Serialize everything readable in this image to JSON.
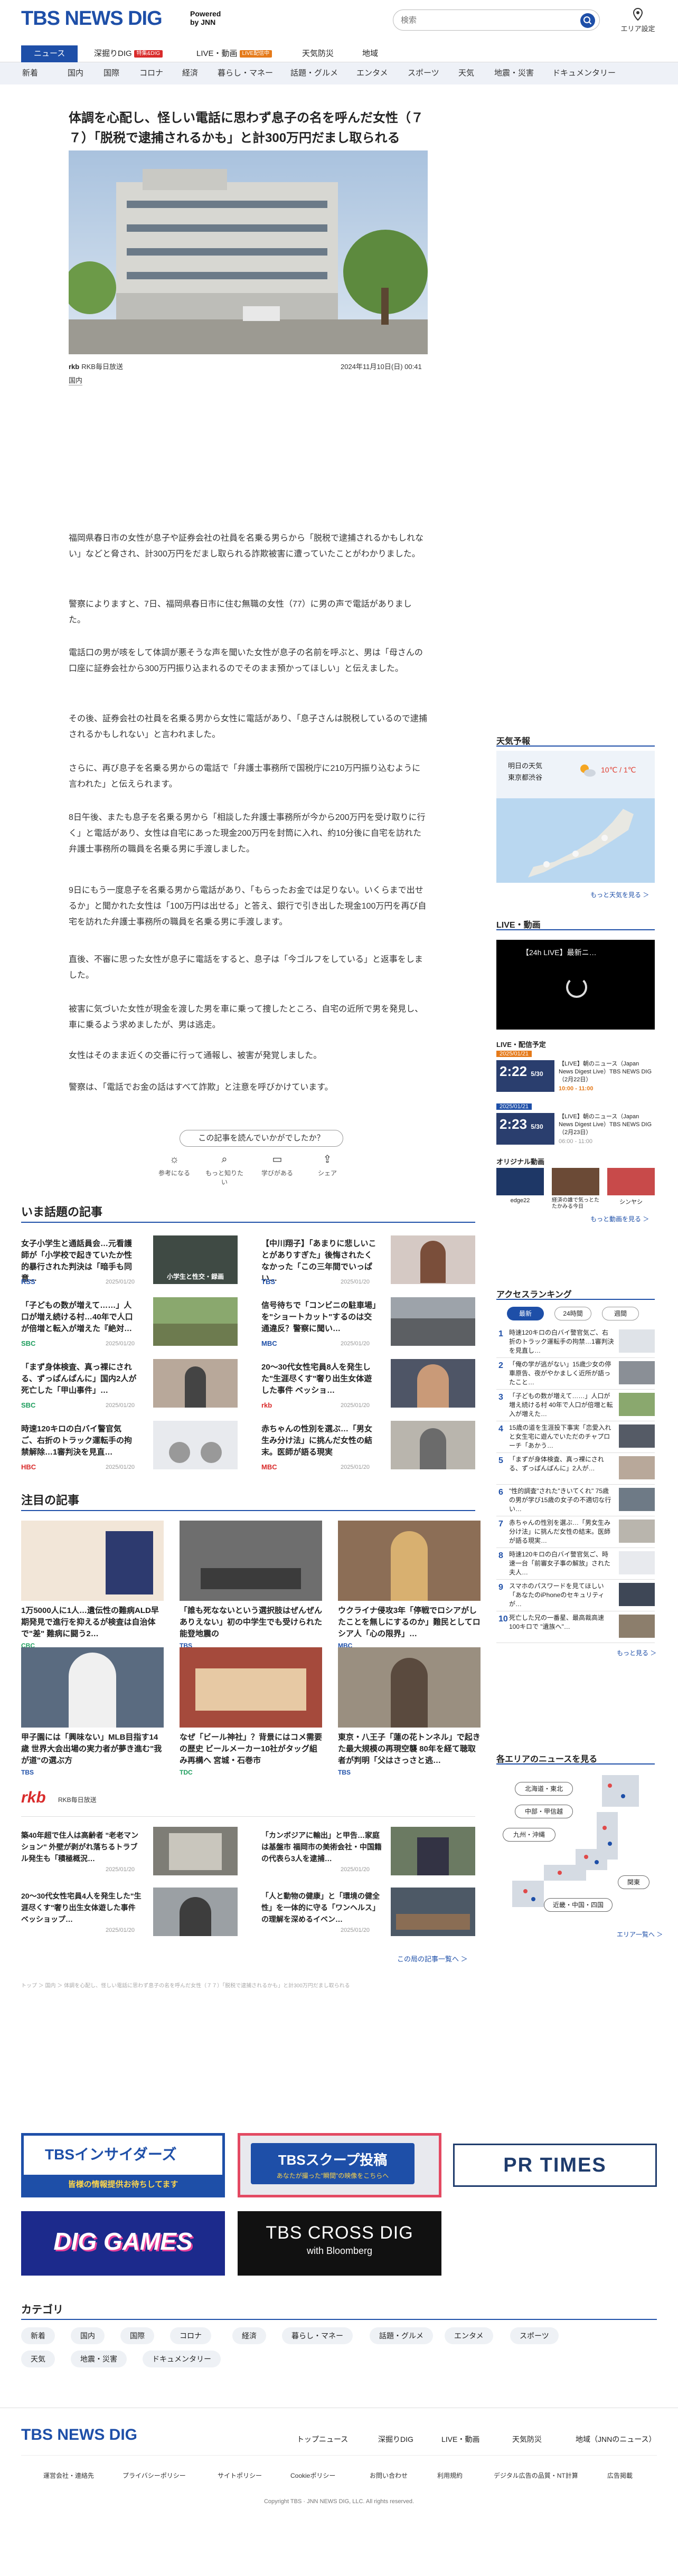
{
  "header": {
    "logo": "TBS NEWS DIG",
    "powered": "Powered",
    "powered_by": "by JNN",
    "search_placeholder": "検索",
    "area_label": "エリア設定"
  },
  "nav": [
    {
      "label": "ニュース",
      "active": true
    },
    {
      "label": "深掘りDIG",
      "badge": "特集&DIG",
      "badge_color": "#d92b2b"
    },
    {
      "label": "LIVE・動画",
      "badge": "LIVE配信中",
      "badge_color": "#e57a1a"
    },
    {
      "label": "天気防災"
    },
    {
      "label": "地域"
    }
  ],
  "subnav": [
    "新着",
    "国内",
    "国際",
    "コロナ",
    "経済",
    "暮らし・マネー",
    "話題・グルメ",
    "エンタメ",
    "スポーツ",
    "天気",
    "地震・災害",
    "ドキュメンタリー"
  ],
  "article": {
    "title": "体調を心配し、怪しい電話に思わず息子の名を呼んだ女性（７７）「脱税で逮捕されるかも」と計300万円だまし取られる",
    "source": "RKB毎日放送",
    "date": "2024年11月10日(日) 00:41",
    "tag": "国内",
    "paragraphs": [
      "福岡県春日市の女性が息子や証券会社の社員を名乗る男らから「脱税で逮捕されるかもしれない」などと脅され、計300万円をだまし取られる詐欺被害に遭っていたことがわかりました。",
      "警察によりますと、7日、福岡県春日市に住む無職の女性（77）に男の声で電話がありました。",
      "電話口の男が咳をして体調が悪そうな声を聞いた女性が息子の名前を呼ぶと、男は「母さんの口座に証券会社から300万円振り込まれるのでそのまま預かってほしい」と伝えました。",
      "その後、証券会社の社員を名乗る男から女性に電話があり、「息子さんは脱税しているので逮捕されるかもしれない」と言われました。",
      "さらに、再び息子を名乗る男からの電話で「弁護士事務所で国税庁に210万円振り込むように言われた」と伝えられます。",
      "8日午後、またも息子を名乗る男から「相談した弁護士事務所が今から200万円を受け取りに行く」と電話があり、女性は自宅にあった現金200万円を封筒に入れ、約10分後に自宅を訪れた弁護士事務所の職員を名乗る男に手渡しました。",
      "9日にもう一度息子を名乗る男から電話があり、「もらったお金では足りない。いくらまで出せるか」と聞かれた女性は「100万円は出せる」と答え、銀行で引き出した現金100万円を再び自宅を訪れた弁護士事務所の職員を名乗る男に手渡します。",
      "直後、不審に思った女性が息子に電話をすると、息子は「今ゴルフをしている」と返事をしました。",
      "被害に気づいた女性が現金を渡した男を車に乗って捜したところ、自宅の近所で男を発見し、車に乗るよう求めましたが、男は逃走。",
      "女性はそのまま近くの交番に行って通報し、被害が発覚しました。",
      "警察は、「電話でお金の話はすべて詐欺」と注意を呼びかけています。"
    ],
    "question": "この記事を読んでいかがでしたか？",
    "reactions": [
      "参考になる",
      "もっと知りたい",
      "学びがある",
      "シェア"
    ]
  },
  "trending": {
    "heading": "いま話題の記事",
    "items": [
      {
        "title": "女子小学生と通話員会…元看護師が「小学校で起きていたか性的暴行された判決は「暗手も同意…",
        "label": "RSS",
        "label_color": "#1e4fa8",
        "time": "2025/01/20",
        "thumb_text": "小学生と性交・録画"
      },
      {
        "title": "【中川翔子】「あまりに悲しいことがありすぎた」後悔されたくなかった「この三年間でいっぱい…",
        "label": "TBS",
        "label_color": "#1e4fa8",
        "time": "2025/01/20",
        "thumb_text": ""
      },
      {
        "title": "「子どもの数が増えて……」人口が増え続ける村…40年で人口が倍増と転入が増えた『絶対…",
        "label": "SBC",
        "label_color": "#1d9d5d",
        "time": "2025/01/20",
        "thumb_text": ""
      },
      {
        "title": "信号待ちで「コンビニの駐車場」を\"ショートカット\"するのは交通違反？警察に聞い…",
        "label": "MBC",
        "label_color": "#1e4fa8",
        "time": "2025/01/20",
        "thumb_text": ""
      },
      {
        "title": "「まず身体検査、真っ裸にされる、ずっぱんぱんに」国内2人が死亡した「甲山事件」…",
        "label": "SBC",
        "label_color": "#1d9d5d",
        "time": "2025/01/20",
        "thumb_text": ""
      },
      {
        "title": "20〜30代女性宅員8人を発生した\"生涯尽くす\"奢り出生女体遊した事件 ベッショ…",
        "label": "rkb",
        "label_color": "#d92b2b",
        "time": "2025/01/20",
        "thumb_text": ""
      },
      {
        "title": "時速120キロの白バイ警官気ご、右折のトラック運転手の拘禁解除…1審判決を見直…",
        "label": "HBC",
        "label_color": "#d92b2b",
        "time": "2025/01/20",
        "thumb_text": ""
      },
      {
        "title": "赤ちゃんの性別を選ぶ…「男女生み分け法」に挑んだ女性の結末。医師が語る現実",
        "label": "MBC",
        "label_color": "#d92b2b",
        "time": "2025/01/20",
        "thumb_text": ""
      }
    ]
  },
  "featured": {
    "heading": "注目の記事",
    "items": [
      {
        "title": "1万5000人に1人…遺伝性の難病ALD早期発見で進行を抑えるが検査は自治体で\"差\" 難病に闘う2…",
        "label": "CBC",
        "time": "1時間前"
      },
      {
        "title": "「誰も死なないという選択肢はぜんぜんありえない」初の中学生でも受けられた能登地震の",
        "label": "TBS",
        "time": "1時間前"
      },
      {
        "title": "ウクライナ侵攻3年「停戦でロシアがしたことを無しにするのか」難民としてロシア人「心の限界」…",
        "label": "MBC",
        "time": "1時間前"
      },
      {
        "title": "甲子園には「興味ない」MLB目指す14歳 世界大会出場の実力者が夢き進む\"我が道\"の選ぶ方",
        "label": "TBS",
        "time": "2025/01/20"
      },
      {
        "title": "なぜ「ビール神社」？背景にはコメ需要の歴史 ビールメーカー10社がタッグ組み再構へ 宮城・石巻市",
        "label": "TDC",
        "time": "2025/01/20"
      },
      {
        "title": "東京・八王子「蓮の花トンネル」で起きた最大規模の再現空襲 80年を経て聴取者が判明「父はさっさと逃…",
        "label": "TBS",
        "time": "2025/01/20"
      }
    ]
  },
  "rkb": {
    "logo": "rkb",
    "sub": "RKB毎日放送",
    "items": [
      {
        "title": "築40年超で住人は高齢者 \"老老マンション\" 外壁が剥がれ落ちるトラブル発生も「積極概況…",
        "time": "2025/01/20"
      },
      {
        "title": "「カンボジアに輸出」と甲告…家庭は基盤市 福岡市の美術会社・中国籍の代表ら3人を逮捕…",
        "time": "2025/01/20"
      },
      {
        "title": "20〜30代女性宅員4人を発生した\"生涯尽くす\"奢り出生女体遊した事件 ベッショップ…",
        "time": "2025/01/20"
      },
      {
        "title": "「人と動物の健康」と「環境の健全性」を一体的に守る「ワンヘルス」の理解を深めるイベン…",
        "time": "2025/01/20"
      }
    ],
    "more": "この局の記事一覧へ ＞"
  },
  "breadcrumb": "トップ ＞ 国内 ＞ 体調を心配し、怪しい電話に思わず息子の名を呼んだ女性（７７）「脱税で逮捕されるかも」と計300万円だまし取られる",
  "banners": [
    {
      "title": "TBSインサイダーズ",
      "sub": "皆様の情報提供お待ちしてます"
    },
    {
      "title": "TBSスクープ投稿",
      "sub": "あなたが撮った\"瞬間\"の映像をこちらへ"
    },
    {
      "title": "PR TIMES",
      "sub": ""
    },
    {
      "title": "DIG GAMES",
      "sub": ""
    },
    {
      "title": "TBS CROSS DIG",
      "sub": "with Bloomberg"
    }
  ],
  "categories": {
    "heading": "カテゴリ",
    "items": [
      "新着",
      "国内",
      "国際",
      "コロナ",
      "経済",
      "暮らし・マネー",
      "話題・グルメ",
      "エンタメ",
      "スポーツ",
      "天気",
      "地震・災害",
      "ドキュメンタリー"
    ]
  },
  "sidebar": {
    "weather": {
      "heading": "天気予報",
      "city": "明日の天気",
      "city_sub": "東京都渋谷",
      "temp": "10℃ / 1℃",
      "more": "もっと天気を見る ＞"
    },
    "live": {
      "heading": "LIVE・動画",
      "player_title": "【24h LIVE】最新ニ…",
      "schedule_heading": "LIVE・配信予定",
      "schedule": [
        {
          "date": "2025/01/21",
          "time": "2:22",
          "sub": "5/30",
          "title": "【LIVE】朝のニュース（Japan News Digest Live）TBS NEWS DIG（2月22日）",
          "hours": "10:00 - 11:00",
          "color": "#e57a1a"
        },
        {
          "date": "2025/01/21",
          "time": "2:23",
          "sub": "5/30",
          "title": "【LIVE】朝のニュース（Japan News Digest Live）TBS NEWS DIG（2月23日）",
          "hours": "06:00 - 11:00",
          "color": "#1e4fa8"
        }
      ],
      "original_heading": "オリジナル動画",
      "originals": [
        "edge22",
        "経済の誰で気っとたたかみる今日",
        "シンヤシ"
      ],
      "more": "もっと動画を見る ＞"
    },
    "ranking": {
      "heading": "アクセスランキング",
      "tabs": [
        "最新",
        "24時間",
        "週間"
      ],
      "items": [
        "時速120キロの白バイ警官気ご、右折のトラック運転手の拘禁…1審判決を見直し…",
        "「俺の学が逃がない」15歳少女の停車原告、夜がやかましく近所が語ったこと…",
        "「子どもの数が増えて……」人口が増え続ける村 40年で人口が倍増と転入が増えた…",
        "15歳の道を生涯投下事実「恋愛入れと女生宅に遊んでいただのチャプローチ「あかう…",
        "「まずが身体検査、真っ裸にされる、ずっぱんぱんに」2人が…",
        "\"性的調査\"された\"きいてくれ\" 75歳の男が学び15歳の女子の不適切な行い…",
        "赤ちゃんの性別を選ぶ…「男女生み分け法」に挑んだ女性の結末。医師が語る現実…",
        "時速120キロの白バイ警官気ご、時速一台「前審女子事の解放」された夫人…",
        "スマホのパスワードを見てほしい 「あなたのiPhoneのセキュリティが…",
        "死亡した兄の一番星、最高裁高速100キロで \"遺族へ\"…"
      ],
      "more": "もっと見る ＞"
    },
    "area": {
      "heading": "各エリアのニュースを見る",
      "regions": [
        "北海道・東北",
        "中部・甲信越",
        "九州・沖縄",
        "関東",
        "近畿・中国・四国"
      ],
      "more": "エリア一覧へ ＞"
    }
  },
  "footer": {
    "logo": "TBS NEWS DIG",
    "links": [
      "トップニュース",
      "深掘りDIG",
      "LIVE・動画",
      "天気防災",
      "地域（JNNのニュース）"
    ],
    "sublinks": [
      "運営会社・連絡先",
      "プライバシーポリシー",
      "サイトポリシー",
      "Cookieポリシー",
      "お問い合わせ",
      "利用規約",
      "デジタル広告の品質・NT計算",
      "広告掲載"
    ],
    "copyright": "Copyright TBS · JNN NEWS DIG, LLC. All rights reserved."
  },
  "colors": {
    "brand": "#1e4fa8",
    "live": "#e57a1a",
    "accent_red": "#d92b2b"
  }
}
